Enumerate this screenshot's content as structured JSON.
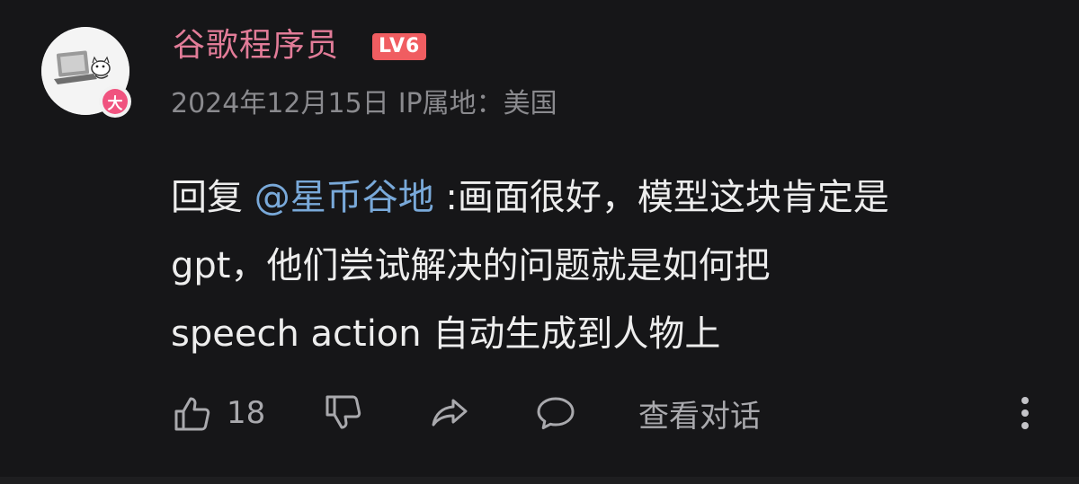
{
  "comment": {
    "username": "谷歌程序员",
    "level": "LV6",
    "badge": "大",
    "date": "2024年12月15日",
    "ip_location": "IP属地：美国",
    "reply_prefix": "回复",
    "mention": "@星币谷地",
    "text_line1": " :画面很好，模型这块肯定是",
    "text_line2": "gpt，他们尝试解决的问题就是如何把",
    "text_line3": "speech action 自动生成到人物上"
  },
  "actions": {
    "like_count": "18",
    "view_dialog_label": "查看对话"
  },
  "colors": {
    "background": "#161618",
    "username": "#e27c98",
    "level_badge": "#f05d61",
    "mention": "#79a9d9",
    "meta": "#8a8a8e",
    "icon": "#a9a9ad"
  },
  "icons": [
    "thumbs-up-icon",
    "thumbs-down-icon",
    "share-icon",
    "comment-bubble-icon",
    "more-vertical-icon"
  ]
}
